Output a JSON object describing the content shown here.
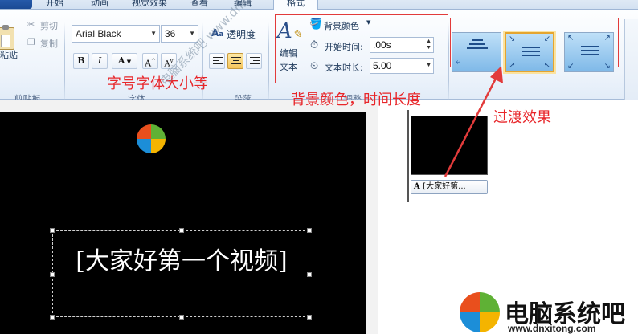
{
  "tabs": [
    {
      "label": "开始"
    },
    {
      "label": "动画"
    },
    {
      "label": "视觉效果"
    },
    {
      "label": "查看"
    },
    {
      "label": "编辑"
    },
    {
      "label": "格式"
    }
  ],
  "clipboard": {
    "paste_label": "粘贴",
    "cut_label": "剪切",
    "copy_label": "复制",
    "group_label": "剪贴板"
  },
  "font": {
    "family": "Arial Black",
    "size": "36",
    "transparency_label": "透明度",
    "bold": "B",
    "italic": "I",
    "color": "A",
    "grow": "A",
    "shrink": "A",
    "group_label": "字体"
  },
  "paragraph": {
    "group_label": "段落"
  },
  "adjust": {
    "edit_text_line1": "编辑",
    "edit_text_line2": "文本",
    "bg_color_label": "背景颜色",
    "start_time_label": "开始时间:",
    "start_time_value": ".00s",
    "duration_label": "文本时长:",
    "duration_value": "5.00",
    "group_label": "调整"
  },
  "preview": {
    "caption": "[大家好第一个视频]"
  },
  "storyboard": {
    "caption_chip": "[大家好第..."
  },
  "annotations": {
    "font_note": "字号字体大小等",
    "bg_note": "背景颜色，时间长度",
    "transition_note": "过渡效果"
  },
  "watermark": "电脑系统吧 www.dnxitong.com",
  "brand": {
    "name": "电脑系统吧",
    "url": "www.dnxitong.com"
  },
  "colors": {
    "annotation": "#e8262a",
    "accent_selected": "#e5a52f"
  }
}
